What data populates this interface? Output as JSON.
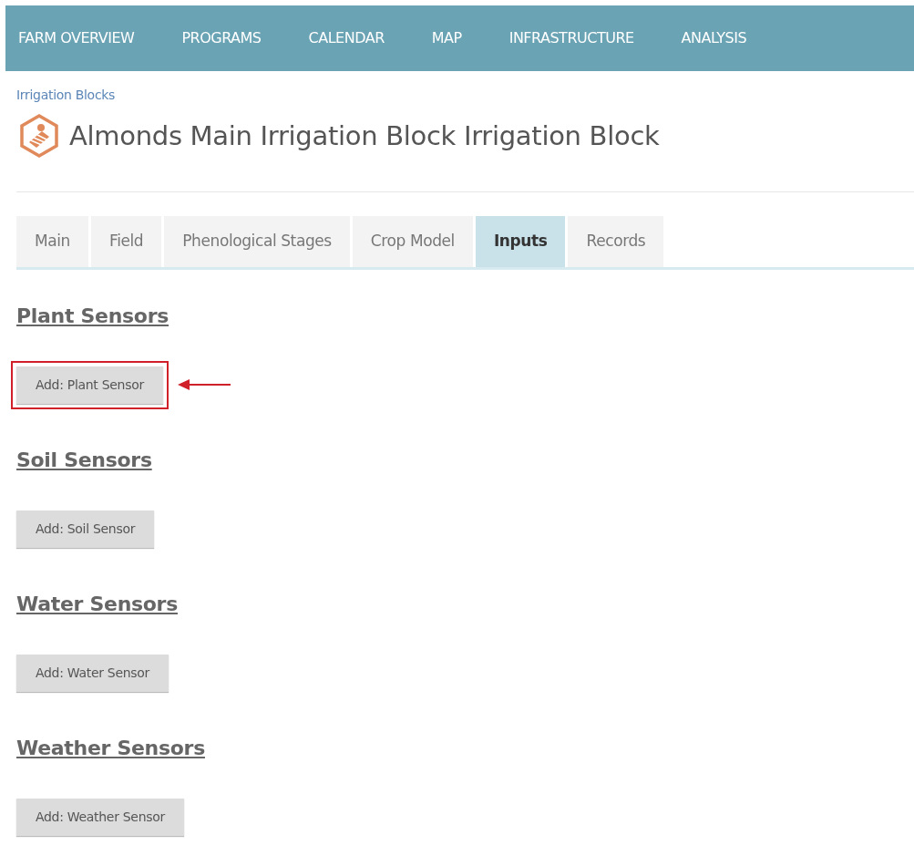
{
  "nav": [
    {
      "label": "FARM OVERVIEW"
    },
    {
      "label": "PROGRAMS"
    },
    {
      "label": "CALENDAR"
    },
    {
      "label": "MAP"
    },
    {
      "label": "INFRASTRUCTURE"
    },
    {
      "label": "ANALYSIS"
    }
  ],
  "breadcrumb": "Irrigation Blocks",
  "title": "Almonds Main Irrigation Block Irrigation Block",
  "tabs": [
    {
      "label": "Main",
      "selected": false
    },
    {
      "label": "Field",
      "selected": false
    },
    {
      "label": "Phenological Stages",
      "selected": false
    },
    {
      "label": "Crop Model",
      "selected": false
    },
    {
      "label": "Inputs",
      "selected": true
    },
    {
      "label": "Records",
      "selected": false
    }
  ],
  "sections": [
    {
      "heading": "Plant Sensors",
      "button": "Add: Plant Sensor",
      "highlighted": true
    },
    {
      "heading": "Soil Sensors",
      "button": "Add: Soil Sensor",
      "highlighted": false
    },
    {
      "heading": "Water Sensors",
      "button": "Add: Water Sensor",
      "highlighted": false
    },
    {
      "heading": "Weather Sensors",
      "button": "Add: Weather Sensor",
      "highlighted": false
    }
  ]
}
